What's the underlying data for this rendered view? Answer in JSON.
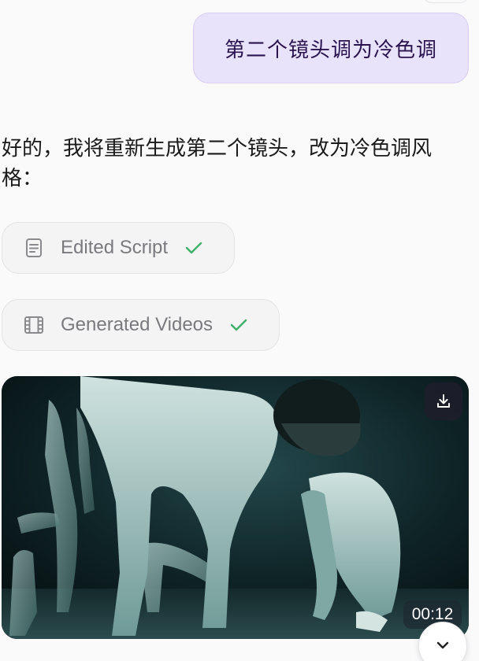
{
  "user_message": {
    "text": "第二个镜头调为冷色调"
  },
  "assistant_message": {
    "text": "好的，我将重新生成第二个镜头，改为冷色调风格："
  },
  "tool_steps": [
    {
      "label": "Edited Script",
      "icon": "document-icon",
      "status": "done"
    },
    {
      "label": "Generated Videos",
      "icon": "film-icon",
      "status": "done"
    }
  ],
  "video": {
    "timestamp": "00:12",
    "download_icon": "download-icon"
  },
  "scroll_down_icon": "chevron-down-icon",
  "colors": {
    "user_bubble_bg": "#e9e2fb",
    "user_text": "#2a1450",
    "check_green": "#3fb16a",
    "chip_bg": "#f4f4f5",
    "video_tint": "#2f6f6c"
  }
}
